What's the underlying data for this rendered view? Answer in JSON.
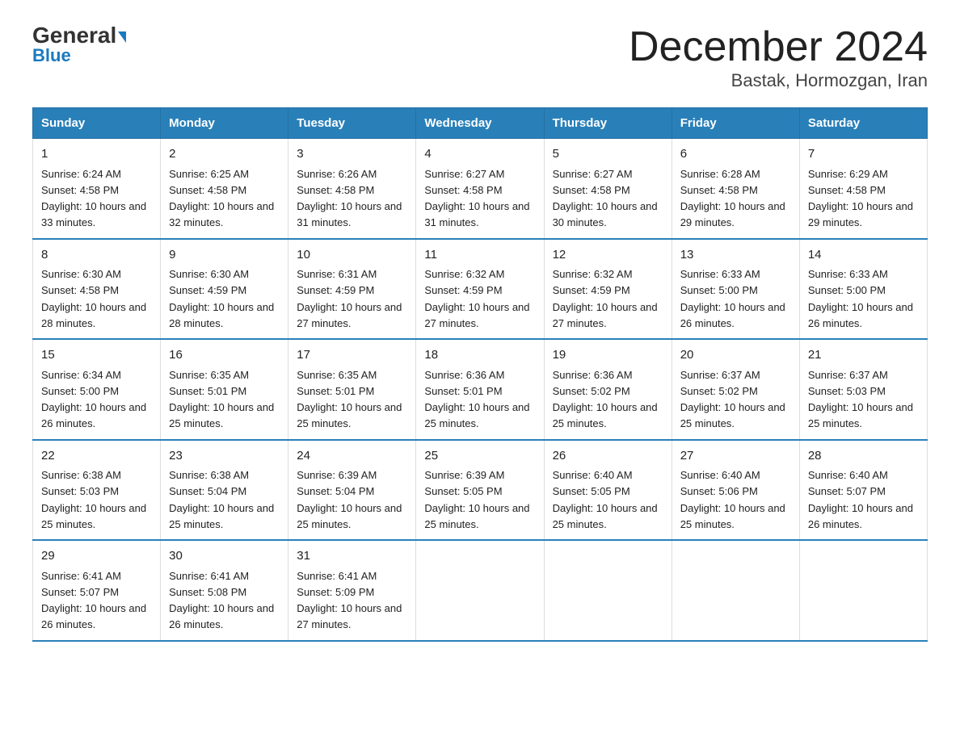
{
  "logo": {
    "general": "General",
    "blue": "Blue"
  },
  "title": "December 2024",
  "subtitle": "Bastak, Hormozgan, Iran",
  "headers": [
    "Sunday",
    "Monday",
    "Tuesday",
    "Wednesday",
    "Thursday",
    "Friday",
    "Saturday"
  ],
  "weeks": [
    [
      {
        "day": "1",
        "sunrise": "6:24 AM",
        "sunset": "4:58 PM",
        "daylight": "10 hours and 33 minutes."
      },
      {
        "day": "2",
        "sunrise": "6:25 AM",
        "sunset": "4:58 PM",
        "daylight": "10 hours and 32 minutes."
      },
      {
        "day": "3",
        "sunrise": "6:26 AM",
        "sunset": "4:58 PM",
        "daylight": "10 hours and 31 minutes."
      },
      {
        "day": "4",
        "sunrise": "6:27 AM",
        "sunset": "4:58 PM",
        "daylight": "10 hours and 31 minutes."
      },
      {
        "day": "5",
        "sunrise": "6:27 AM",
        "sunset": "4:58 PM",
        "daylight": "10 hours and 30 minutes."
      },
      {
        "day": "6",
        "sunrise": "6:28 AM",
        "sunset": "4:58 PM",
        "daylight": "10 hours and 29 minutes."
      },
      {
        "day": "7",
        "sunrise": "6:29 AM",
        "sunset": "4:58 PM",
        "daylight": "10 hours and 29 minutes."
      }
    ],
    [
      {
        "day": "8",
        "sunrise": "6:30 AM",
        "sunset": "4:58 PM",
        "daylight": "10 hours and 28 minutes."
      },
      {
        "day": "9",
        "sunrise": "6:30 AM",
        "sunset": "4:59 PM",
        "daylight": "10 hours and 28 minutes."
      },
      {
        "day": "10",
        "sunrise": "6:31 AM",
        "sunset": "4:59 PM",
        "daylight": "10 hours and 27 minutes."
      },
      {
        "day": "11",
        "sunrise": "6:32 AM",
        "sunset": "4:59 PM",
        "daylight": "10 hours and 27 minutes."
      },
      {
        "day": "12",
        "sunrise": "6:32 AM",
        "sunset": "4:59 PM",
        "daylight": "10 hours and 27 minutes."
      },
      {
        "day": "13",
        "sunrise": "6:33 AM",
        "sunset": "5:00 PM",
        "daylight": "10 hours and 26 minutes."
      },
      {
        "day": "14",
        "sunrise": "6:33 AM",
        "sunset": "5:00 PM",
        "daylight": "10 hours and 26 minutes."
      }
    ],
    [
      {
        "day": "15",
        "sunrise": "6:34 AM",
        "sunset": "5:00 PM",
        "daylight": "10 hours and 26 minutes."
      },
      {
        "day": "16",
        "sunrise": "6:35 AM",
        "sunset": "5:01 PM",
        "daylight": "10 hours and 25 minutes."
      },
      {
        "day": "17",
        "sunrise": "6:35 AM",
        "sunset": "5:01 PM",
        "daylight": "10 hours and 25 minutes."
      },
      {
        "day": "18",
        "sunrise": "6:36 AM",
        "sunset": "5:01 PM",
        "daylight": "10 hours and 25 minutes."
      },
      {
        "day": "19",
        "sunrise": "6:36 AM",
        "sunset": "5:02 PM",
        "daylight": "10 hours and 25 minutes."
      },
      {
        "day": "20",
        "sunrise": "6:37 AM",
        "sunset": "5:02 PM",
        "daylight": "10 hours and 25 minutes."
      },
      {
        "day": "21",
        "sunrise": "6:37 AM",
        "sunset": "5:03 PM",
        "daylight": "10 hours and 25 minutes."
      }
    ],
    [
      {
        "day": "22",
        "sunrise": "6:38 AM",
        "sunset": "5:03 PM",
        "daylight": "10 hours and 25 minutes."
      },
      {
        "day": "23",
        "sunrise": "6:38 AM",
        "sunset": "5:04 PM",
        "daylight": "10 hours and 25 minutes."
      },
      {
        "day": "24",
        "sunrise": "6:39 AM",
        "sunset": "5:04 PM",
        "daylight": "10 hours and 25 minutes."
      },
      {
        "day": "25",
        "sunrise": "6:39 AM",
        "sunset": "5:05 PM",
        "daylight": "10 hours and 25 minutes."
      },
      {
        "day": "26",
        "sunrise": "6:40 AM",
        "sunset": "5:05 PM",
        "daylight": "10 hours and 25 minutes."
      },
      {
        "day": "27",
        "sunrise": "6:40 AM",
        "sunset": "5:06 PM",
        "daylight": "10 hours and 25 minutes."
      },
      {
        "day": "28",
        "sunrise": "6:40 AM",
        "sunset": "5:07 PM",
        "daylight": "10 hours and 26 minutes."
      }
    ],
    [
      {
        "day": "29",
        "sunrise": "6:41 AM",
        "sunset": "5:07 PM",
        "daylight": "10 hours and 26 minutes."
      },
      {
        "day": "30",
        "sunrise": "6:41 AM",
        "sunset": "5:08 PM",
        "daylight": "10 hours and 26 minutes."
      },
      {
        "day": "31",
        "sunrise": "6:41 AM",
        "sunset": "5:09 PM",
        "daylight": "10 hours and 27 minutes."
      },
      null,
      null,
      null,
      null
    ]
  ]
}
